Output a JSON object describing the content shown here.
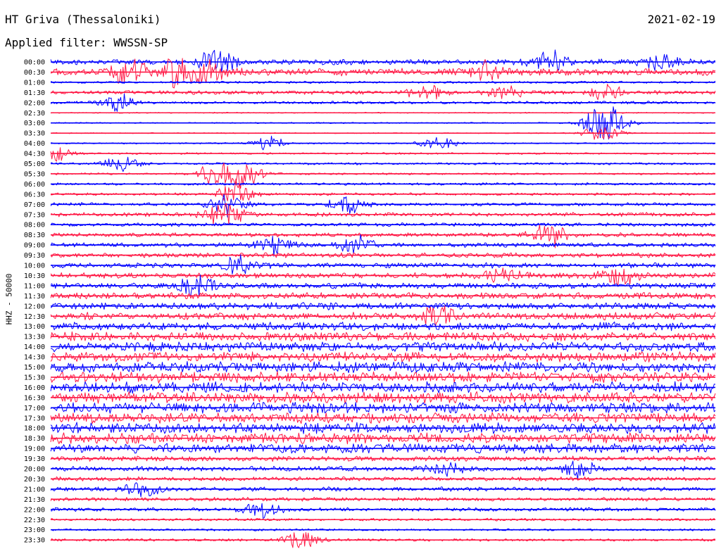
{
  "header": {
    "station": "HT Griva (Thessaloniki)",
    "date": "2021-02-19",
    "filter": "Applied filter: WWSSN-SP"
  },
  "channel_label": "HHZ - 50000",
  "colors": {
    "trace_even": "#0000ff",
    "trace_odd": "#ff1744",
    "text": "#000000",
    "background": "#ffffff"
  },
  "chart_data": {
    "type": "line",
    "title": "",
    "xlabel": "",
    "ylabel": "HHZ - 50000",
    "grid": false,
    "legend": "none",
    "x_unit": "minutes into half-hour window",
    "xlim": [
      0,
      30
    ],
    "tick_labels": [
      "00:00",
      "00:30",
      "01:00",
      "01:30",
      "02:00",
      "02:30",
      "03:00",
      "03:30",
      "04:00",
      "04:30",
      "05:00",
      "05:30",
      "06:00",
      "06:30",
      "07:00",
      "07:30",
      "08:00",
      "08:30",
      "09:00",
      "09:30",
      "10:00",
      "10:30",
      "11:00",
      "11:30",
      "12:00",
      "12:30",
      "13:00",
      "13:30",
      "14:00",
      "14:30",
      "15:00",
      "15:30",
      "16:00",
      "16:30",
      "17:00",
      "17:30",
      "18:00",
      "18:30",
      "19:00",
      "19:30",
      "20:00",
      "20:30",
      "21:00",
      "21:30",
      "22:00",
      "22:30",
      "23:00",
      "23:30"
    ],
    "relative_amplitude": [
      0.45,
      0.6,
      0.15,
      0.3,
      0.2,
      0.05,
      0.06,
      0.04,
      0.08,
      0.12,
      0.15,
      0.12,
      0.18,
      0.18,
      0.25,
      0.32,
      0.28,
      0.32,
      0.35,
      0.38,
      0.42,
      0.45,
      0.48,
      0.52,
      0.58,
      0.62,
      0.68,
      0.78,
      0.8,
      0.82,
      0.88,
      0.92,
      0.95,
      0.95,
      0.92,
      0.9,
      0.9,
      0.88,
      0.8,
      0.42,
      0.38,
      0.32,
      0.32,
      0.3,
      0.28,
      0.18,
      0.14,
      0.18
    ],
    "events": [
      {
        "row": 0,
        "minute": 7.5,
        "strength": 2.2
      },
      {
        "row": 0,
        "minute": 22.5,
        "strength": 2.0
      },
      {
        "row": 0,
        "minute": 27.5,
        "strength": 1.8
      },
      {
        "row": 1,
        "minute": 3.5,
        "strength": 2.6
      },
      {
        "row": 1,
        "minute": 5.5,
        "strength": 2.4
      },
      {
        "row": 1,
        "minute": 7.0,
        "strength": 2.6
      },
      {
        "row": 1,
        "minute": 19.8,
        "strength": 1.5
      },
      {
        "row": 3,
        "minute": 17.0,
        "strength": 1.5
      },
      {
        "row": 3,
        "minute": 20.5,
        "strength": 1.4
      },
      {
        "row": 3,
        "minute": 25.0,
        "strength": 1.5
      },
      {
        "row": 4,
        "minute": 3.0,
        "strength": 1.6
      },
      {
        "row": 6,
        "minute": 24.8,
        "strength": 3.0
      },
      {
        "row": 6,
        "minute": 25.3,
        "strength": 2.6
      },
      {
        "row": 7,
        "minute": 24.9,
        "strength": 2.0
      },
      {
        "row": 8,
        "minute": 17.5,
        "strength": 1.4
      },
      {
        "row": 8,
        "minute": 9.8,
        "strength": 1.2
      },
      {
        "row": 9,
        "minute": 0.2,
        "strength": 1.8
      },
      {
        "row": 10,
        "minute": 3.2,
        "strength": 1.5
      },
      {
        "row": 11,
        "minute": 7.5,
        "strength": 2.2
      },
      {
        "row": 11,
        "minute": 8.8,
        "strength": 2.5
      },
      {
        "row": 13,
        "minute": 8.4,
        "strength": 2.5
      },
      {
        "row": 14,
        "minute": 8.0,
        "strength": 2.2
      },
      {
        "row": 14,
        "minute": 13.4,
        "strength": 1.5
      },
      {
        "row": 15,
        "minute": 7.8,
        "strength": 3.0
      },
      {
        "row": 17,
        "minute": 22.5,
        "strength": 2.2
      },
      {
        "row": 18,
        "minute": 10.0,
        "strength": 1.6
      },
      {
        "row": 18,
        "minute": 13.8,
        "strength": 1.6
      },
      {
        "row": 20,
        "minute": 8.5,
        "strength": 2.0
      },
      {
        "row": 21,
        "minute": 20.3,
        "strength": 1.6
      },
      {
        "row": 21,
        "minute": 25.6,
        "strength": 1.8
      },
      {
        "row": 22,
        "minute": 6.6,
        "strength": 2.0
      },
      {
        "row": 25,
        "minute": 17.5,
        "strength": 1.5
      },
      {
        "row": 40,
        "minute": 17.8,
        "strength": 1.4
      },
      {
        "row": 40,
        "minute": 23.8,
        "strength": 1.4
      },
      {
        "row": 42,
        "minute": 4.2,
        "strength": 1.4
      },
      {
        "row": 44,
        "minute": 9.5,
        "strength": 1.4
      },
      {
        "row": 47,
        "minute": 11.3,
        "strength": 1.5
      }
    ]
  }
}
